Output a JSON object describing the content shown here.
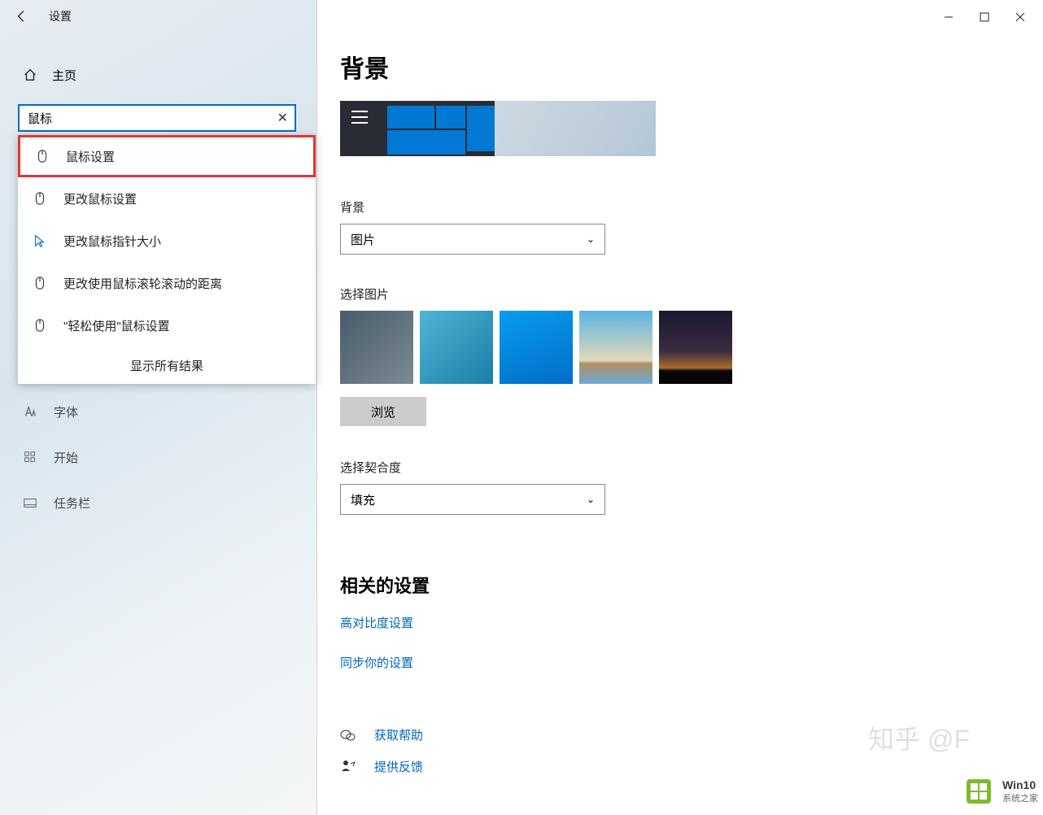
{
  "header": {
    "title": "设置",
    "home_label": "主页"
  },
  "search": {
    "value": "鼠标"
  },
  "results": {
    "items": [
      "鼠标设置",
      "更改鼠标设置",
      "更改鼠标指针大小",
      "更改使用鼠标滚轮滚动的距离",
      "\"轻松使用\"鼠标设置"
    ],
    "show_all": "显示所有结果"
  },
  "sidebar": {
    "fonts_label": "字体",
    "start_label": "开始",
    "taskbar_label": "任务栏"
  },
  "main": {
    "title": "背景",
    "bg_label": "背景",
    "bg_value": "图片",
    "choose_label": "选择图片",
    "browse": "浏览",
    "fit_label": "选择契合度",
    "fit_value": "填充",
    "related_title": "相关的设置",
    "link1": "高对比度设置",
    "link2": "同步你的设置",
    "help": "获取帮助",
    "feedback": "提供反馈"
  },
  "watermark": {
    "zhihu": "知乎 @F",
    "brand": "Win10",
    "brand2": "系统之家"
  }
}
